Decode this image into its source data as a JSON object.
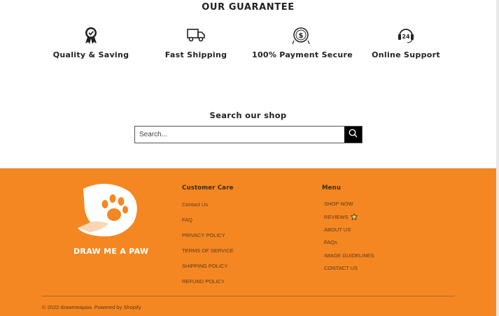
{
  "guarantee": {
    "title": "OUR GUARANTEE",
    "features": [
      {
        "label": "Quality & Saving",
        "icon": "award-ribbon-icon"
      },
      {
        "label": "Fast Shipping",
        "icon": "delivery-truck-icon"
      },
      {
        "label": "100% Payment Secure",
        "icon": "secure-coin-icon"
      },
      {
        "label": "Online Support",
        "icon": "support-24-icon"
      }
    ]
  },
  "search": {
    "title": "Search our shop",
    "placeholder": "Search...",
    "icon": "search-icon"
  },
  "footer": {
    "background_color": "#f58722",
    "brand": "DRAW ME A PAW",
    "customer_care": {
      "title": "Customer Care",
      "links": [
        "Contact Us",
        "FAQ",
        "PRIVACY POLICY",
        "TERMS OF SERVICE",
        "SHIPPING POLICY",
        "REFUND POLICY"
      ]
    },
    "menu": {
      "title": "Menu",
      "links": [
        "SHOP NOW",
        "REVIEWS",
        "ABOUT US",
        "FAQs",
        "IMAGE GUIDELINES",
        "CONTACT US"
      ]
    },
    "copyright": "© 2022 drawmeapaw. Powered by Shopify"
  }
}
